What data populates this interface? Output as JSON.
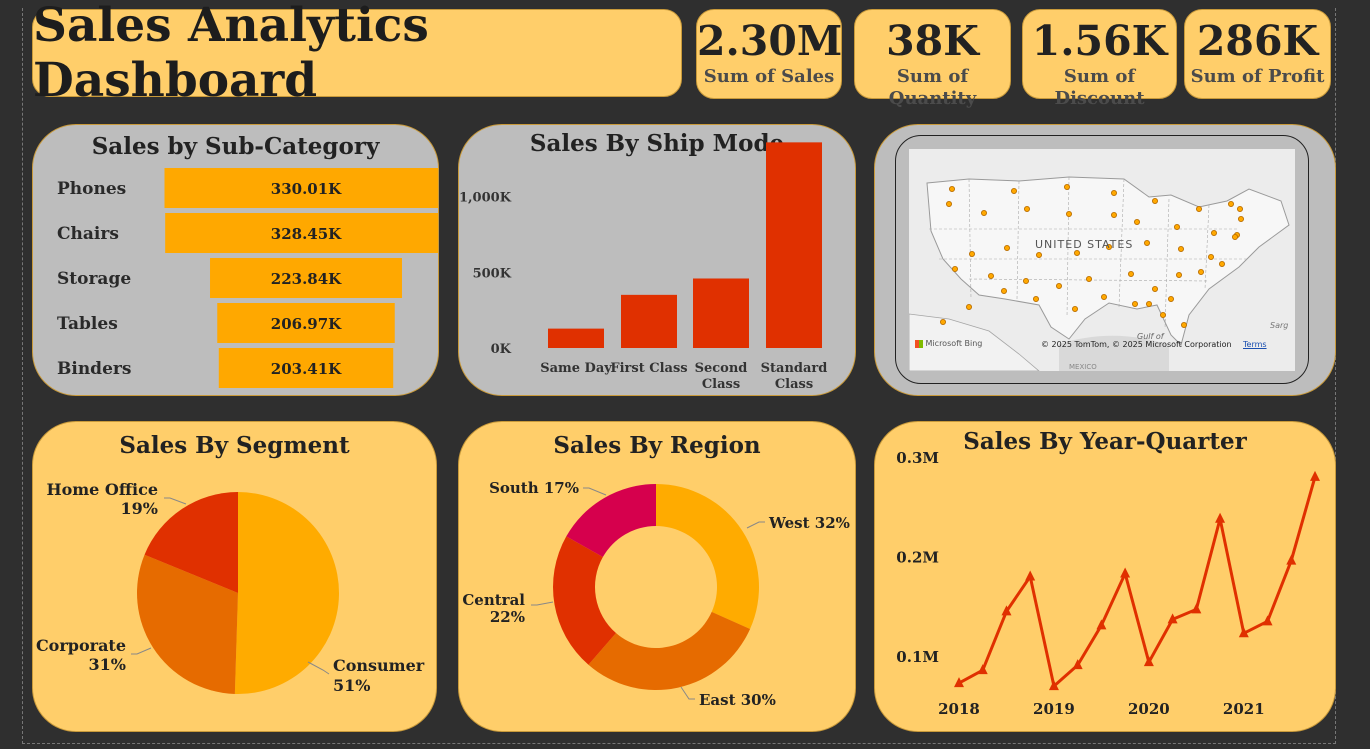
{
  "header": {
    "title": "Sales Analytics Dashboard"
  },
  "kpis": [
    {
      "value": "2.30M",
      "label": "Sum of Sales"
    },
    {
      "value": "38K",
      "label": "Sum of Quantity"
    },
    {
      "value": "1.56K",
      "label": "Sum of Discount"
    },
    {
      "value": "286K",
      "label": "Sum of Profit"
    }
  ],
  "colors": {
    "background": "#2f2f2f",
    "card_gold": "#ffce6a",
    "card_gray": "#bdbdbd",
    "bar_orange": "#ffa800",
    "bar_red": "#e03000",
    "consumer": "#ffab00",
    "corporate": "#e66b00",
    "home_office": "#e03000",
    "south": "#d6004d"
  },
  "map": {
    "label": "UNITED STATES",
    "credit": "© 2025 TomTom, © 2025 Microsoft Corporation",
    "terms": "Terms",
    "brand": "Microsoft Bing",
    "gulf": "Gulf of",
    "corner": "Sarg",
    "mexico": "MEXICO"
  },
  "chart_data": [
    {
      "type": "bar",
      "orientation": "horizontal",
      "title": "Sales by Sub-Category",
      "categories": [
        "Phones",
        "Chairs",
        "Storage",
        "Tables",
        "Binders"
      ],
      "values": [
        330010,
        328450,
        223840,
        206970,
        203410
      ],
      "data_labels": [
        "330.01K",
        "328.45K",
        "223.84K",
        "206.97K",
        "203.41K"
      ]
    },
    {
      "type": "bar",
      "title": "Sales By Ship Mode",
      "categories": [
        "Same Day",
        "First Class",
        "Second Class",
        "Standard Class"
      ],
      "category_lines": [
        [
          "Same Day"
        ],
        [
          "First Class"
        ],
        [
          "Second",
          "Class"
        ],
        [
          "Standard",
          "Class"
        ]
      ],
      "values": [
        128000,
        351000,
        459000,
        1358000
      ],
      "yticks": [
        "0K",
        "500K",
        "1,000K"
      ],
      "ytick_values": [
        0,
        500000,
        1000000
      ],
      "ylim": [
        0,
        1400000
      ]
    },
    {
      "type": "pie",
      "title": "Sales By Segment",
      "slices": [
        {
          "name": "Consumer",
          "pct": 51,
          "label": "51%"
        },
        {
          "name": "Corporate",
          "pct": 31,
          "label": "31%"
        },
        {
          "name": "Home Office",
          "pct": 19,
          "label": "19%"
        }
      ]
    },
    {
      "type": "pie",
      "subtype": "donut",
      "title": "Sales By Region",
      "slices": [
        {
          "name": "West",
          "pct": 32,
          "label": "West 32%"
        },
        {
          "name": "East",
          "pct": 30,
          "label": "East 30%"
        },
        {
          "name": "Central",
          "pct": 22,
          "label": "Central 22%"
        },
        {
          "name": "South",
          "pct": 17,
          "label": "South 17%"
        }
      ]
    },
    {
      "type": "line",
      "title": "Sales By Year-Quarter",
      "x": [
        "2018 Q1",
        "2018 Q2",
        "2018 Q3",
        "2018 Q4",
        "2019 Q1",
        "2019 Q2",
        "2019 Q3",
        "2019 Q4",
        "2020 Q1",
        "2020 Q2",
        "2020 Q3",
        "2020 Q4",
        "2021 Q1",
        "2021 Q2",
        "2021 Q3",
        "2021 Q4"
      ],
      "values": [
        74000,
        87000,
        146000,
        181000,
        71000,
        92000,
        132000,
        184000,
        95000,
        138000,
        148000,
        239000,
        124000,
        136000,
        197000,
        281000
      ],
      "xticks": [
        "2018",
        "2019",
        "2020",
        "2021"
      ],
      "yticks": [
        "0.1M",
        "0.2M",
        "0.3M"
      ],
      "ytick_values": [
        100000,
        200000,
        300000
      ],
      "ylim": [
        50000,
        300000
      ]
    }
  ]
}
